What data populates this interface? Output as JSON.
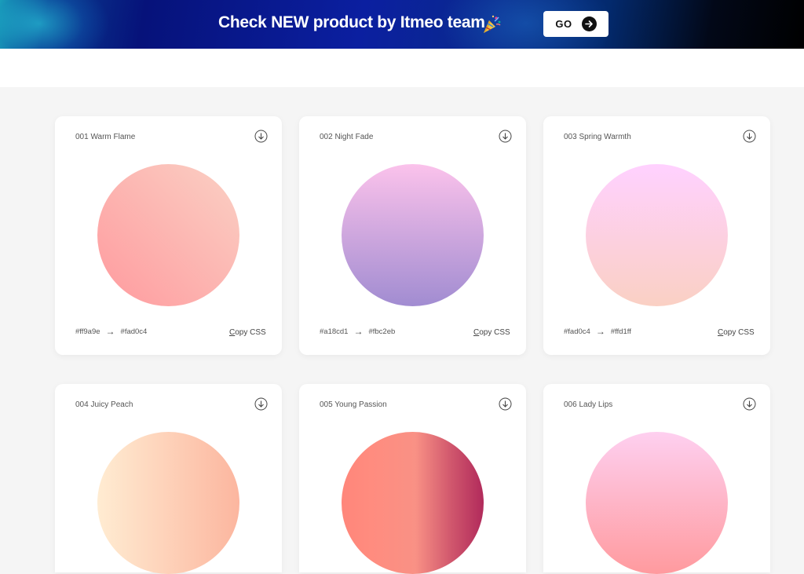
{
  "banner": {
    "text": "Check NEW product by Itmeo team",
    "go_label": "GO"
  },
  "gradients": [
    {
      "name": "001 Warm Flame",
      "from": "#ff9a9e",
      "to": "#fad0c4",
      "arrow": "→",
      "copy_first": "C",
      "copy_rest": "opy CSS"
    },
    {
      "name": "002 Night Fade",
      "from": "#a18cd1",
      "to": "#fbc2eb",
      "arrow": "→",
      "copy_first": "C",
      "copy_rest": "opy CSS"
    },
    {
      "name": "003 Spring Warmth",
      "from": "#fad0c4",
      "to": "#ffd1ff",
      "arrow": "→",
      "copy_first": "C",
      "copy_rest": "opy CSS"
    },
    {
      "name": "004 Juicy Peach"
    },
    {
      "name": "005 Young Passion"
    },
    {
      "name": "006 Lady Lips"
    }
  ],
  "colors": {
    "warm_flame": [
      "#ff9a9e",
      "#fad0c4"
    ],
    "night_fade": [
      "#a18cd1",
      "#fbc2eb"
    ],
    "spring_warmth": [
      "#fad0c4",
      "#ffd1ff"
    ],
    "juicy_peach": [
      "#ffecd2",
      "#fcb69f"
    ],
    "young_passion": [
      "#ff8177",
      "#ff867a",
      "#ff8c7f",
      "#f99185",
      "#cf556c",
      "#b12a5b"
    ],
    "lady_lips": [
      "#ff9a9e",
      "#fecfef"
    ]
  }
}
